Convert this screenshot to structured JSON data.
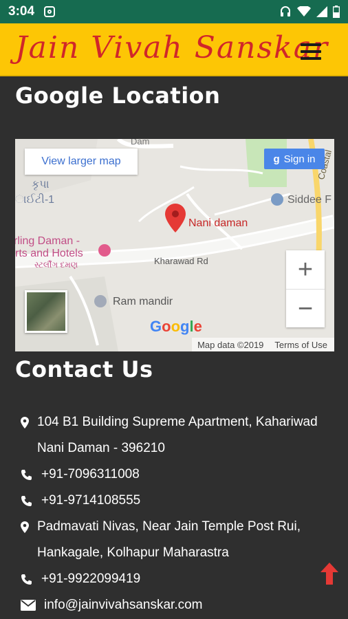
{
  "status_bar": {
    "time": "3:04"
  },
  "header": {
    "logo_text": "Jain Vivah Sanskar"
  },
  "google_location": {
    "title": "Google Location",
    "map": {
      "view_larger_label": "View larger map",
      "sign_in_label": "Sign in",
      "marker_label": "Nani daman",
      "road_label": "Kharawad Rd",
      "place_labels": {
        "siddee": "Siddee F",
        "sterling": "rling Daman -",
        "sterling2": "rts and Hotels",
        "sterling_gu": "સ્ટર્લીંગ દમણ",
        "ram_mandir": "Ram mandir",
        "gujarati1": "કૃપા",
        "gujarati2": "ાઈટી-1",
        "dam": "Dam",
        "coastal": "Coastal"
      },
      "zoom_in": "+",
      "zoom_out": "−",
      "map_data": "Map data ©2019",
      "terms": "Terms of Use",
      "google_letters": [
        "G",
        "o",
        "o",
        "g",
        "l",
        "e"
      ],
      "google_colors": [
        "#4285f4",
        "#ea4335",
        "#fbbc05",
        "#4285f4",
        "#34a853",
        "#ea4335"
      ]
    }
  },
  "contact": {
    "title": "Contact Us",
    "items": [
      {
        "type": "location",
        "text": "104 B1 Building Supreme Apartment, Kahariwad Nani Daman - 396210"
      },
      {
        "type": "phone",
        "text": "+91-7096311008"
      },
      {
        "type": "phone",
        "text": "+91-9714108555"
      },
      {
        "type": "location",
        "text": "Padmavati Nivas, Near Jain Temple Post Rui, Hankagale, Kolhapur Maharastra"
      },
      {
        "type": "phone",
        "text": "+91-9922099419"
      },
      {
        "type": "email",
        "text": "info@jainvivahsanskar.com"
      }
    ]
  },
  "colors": {
    "header_bg": "#fdc605",
    "logo": "#d0262a",
    "status_bar": "#166b50",
    "body_bg": "#2f2f2f",
    "to_top": "#e53935"
  }
}
